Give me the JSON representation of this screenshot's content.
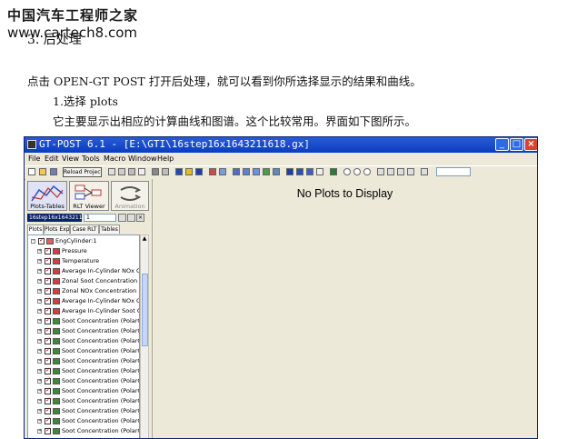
{
  "watermark": {
    "line1": "中国汽车工程师之家",
    "line2": "www.cartech8.com"
  },
  "section_title": "3. 后处理",
  "paragraphs": {
    "intro": "点击 OPEN-GT POST 打开后处理，就可以看到你所选择显示的结果和曲线。",
    "item1": "1.选择 plots",
    "desc": "它主要显示出相应的计算曲线和图谱。这个比较常用。界面如下图所示。"
  },
  "window": {
    "title": "GT-POST 6.1 - [E:\\GTI\\16step16x1643211618.gx]",
    "controls": {
      "minimize": "_",
      "maximize": "□",
      "close": "×"
    }
  },
  "menu": [
    "File",
    "Edit",
    "View",
    "Tools",
    "Macro",
    "Window",
    "Help"
  ],
  "toolbar": {
    "reload_label": "Reload Project"
  },
  "left_panel": {
    "buttons": [
      "Plots-Tables",
      "RLT Viewer",
      "Animation"
    ],
    "file_label": "16step16x16432116",
    "spinner_value": "1",
    "tabs": [
      "Plots",
      "Plots Expl",
      "Case RLT",
      "Tables"
    ],
    "tree": {
      "root": "EngCylinder:1",
      "items": [
        "Pressure",
        "Temperature",
        "Average In-Cylinder NOx Co",
        "Zonal Soot Concentration",
        "Zonal NOx Concentration",
        "Average In-Cylinder NOx Co",
        "Average In-Cylinder Soot Co",
        "Soot Concentration (PolarC",
        "Soot Concentration (PolarC",
        "Soot Concentration (PolarC",
        "Soot Concentration (PolarC",
        "Soot Concentration (PolarC",
        "Soot Concentration (PolarC",
        "Soot Concentration (PolarC",
        "Soot Concentration (PolarC",
        "Soot Concentration (PolarC",
        "Soot Concentration (PolarC",
        "Soot Concentration (PolarC",
        "Soot Concentration (PolarC"
      ]
    }
  },
  "main": {
    "message": "No Plots to Display"
  },
  "colors": {
    "titlebar": "#0a3cc0",
    "window_bg": "#ece9d8",
    "check_red": "#cc0000"
  }
}
